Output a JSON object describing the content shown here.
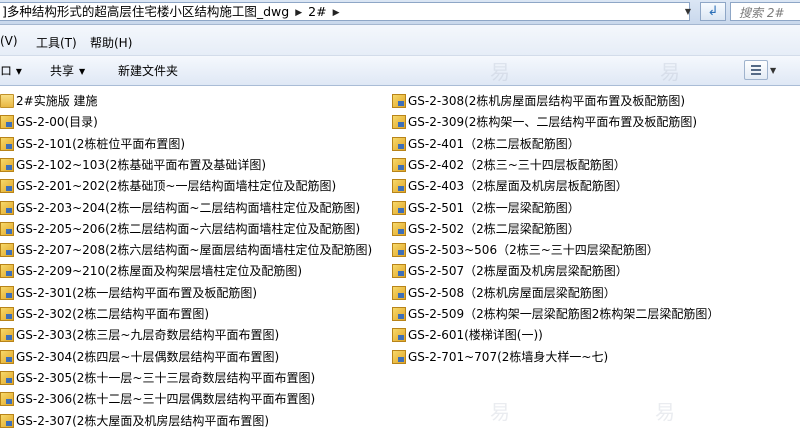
{
  "address": {
    "path_segment": "]多种结构形式的超高层住宅楼小区结构施工图_dwg",
    "sub_segment": "2#",
    "search_placeholder": "搜索 2#"
  },
  "icons": {
    "separator": "▶",
    "dropdown": "▼",
    "refresh": "↲"
  },
  "menu": {
    "items": [
      "(V)",
      "工具(T)",
      "帮助(H)"
    ]
  },
  "toolbar": {
    "left_partial": "ロ ▾",
    "share_label": "共享",
    "new_folder_label": "新建文件夹"
  },
  "files": {
    "left": [
      {
        "name": "2#实施版  建施",
        "type": "folder"
      },
      {
        "name": "GS-2-00(目录)",
        "type": "dwg"
      },
      {
        "name": "GS-2-101(2栋桩位平面布置图)",
        "type": "dwg"
      },
      {
        "name": "GS-2-102~103(2栋基础平面布置及基础详图)",
        "type": "dwg"
      },
      {
        "name": "GS-2-201~202(2栋基础顶~一层结构面墙柱定位及配筋图)",
        "type": "dwg"
      },
      {
        "name": "GS-2-203~204(2栋一层结构面~二层结构面墙柱定位及配筋图)",
        "type": "dwg"
      },
      {
        "name": "GS-2-205~206(2栋二层结构面~六层结构面墙柱定位及配筋图)",
        "type": "dwg"
      },
      {
        "name": "GS-2-207~208(2栋六层结构面~屋面层结构面墙柱定位及配筋图)",
        "type": "dwg"
      },
      {
        "name": "GS-2-209~210(2栋屋面及构架层墙柱定位及配筋图)",
        "type": "dwg"
      },
      {
        "name": "GS-2-301(2栋一层结构平面布置及板配筋图)",
        "type": "dwg"
      },
      {
        "name": "GS-2-302(2栋二层结构平面布置图)",
        "type": "dwg"
      },
      {
        "name": "GS-2-303(2栋三层~九层奇数层结构平面布置图)",
        "type": "dwg"
      },
      {
        "name": "GS-2-304(2栋四层~十层偶数层结构平面布置图)",
        "type": "dwg"
      },
      {
        "name": "GS-2-305(2栋十一层~三十三层奇数层结构平面布置图)",
        "type": "dwg"
      },
      {
        "name": "GS-2-306(2栋十二层~三十四层偶数层结构平面布置图)",
        "type": "dwg"
      },
      {
        "name": "GS-2-307(2栋大屋面及机房层结构平面布置图)",
        "type": "dwg"
      }
    ],
    "right": [
      {
        "name": "GS-2-308(2栋机房屋面层结构平面布置及板配筋图)",
        "type": "dwg"
      },
      {
        "name": "GS-2-309(2栋构架一、二层结构平面布置及板配筋图)",
        "type": "dwg"
      },
      {
        "name": "GS-2-401（2栋二层板配筋图）",
        "type": "dwg"
      },
      {
        "name": "GS-2-402（2栋三~三十四层板配筋图）",
        "type": "dwg"
      },
      {
        "name": "GS-2-403（2栋屋面及机房层板配筋图）",
        "type": "dwg"
      },
      {
        "name": "GS-2-501（2栋一层梁配筋图）",
        "type": "dwg"
      },
      {
        "name": "GS-2-502（2栋二层梁配筋图）",
        "type": "dwg"
      },
      {
        "name": "GS-2-503~506（2栋三~三十四层梁配筋图）",
        "type": "dwg"
      },
      {
        "name": "GS-2-507（2栋屋面及机房层梁配筋图）",
        "type": "dwg"
      },
      {
        "name": "GS-2-508（2栋机房屋面层梁配筋图）",
        "type": "dwg"
      },
      {
        "name": "GS-2-509（2栋构架一层梁配筋图2栋构架二层梁配筋图）",
        "type": "dwg"
      },
      {
        "name": "GS-2-601(楼梯详图(一))",
        "type": "dwg"
      },
      {
        "name": "GS-2-701~707(2栋墙身大样一~七)",
        "type": "dwg"
      }
    ]
  },
  "colors": {
    "chrome_top": "#dbe6f4",
    "toolbar": "#e6edf7",
    "dwg_icon": "#e0a72a",
    "folder_icon": "#e8b744"
  }
}
